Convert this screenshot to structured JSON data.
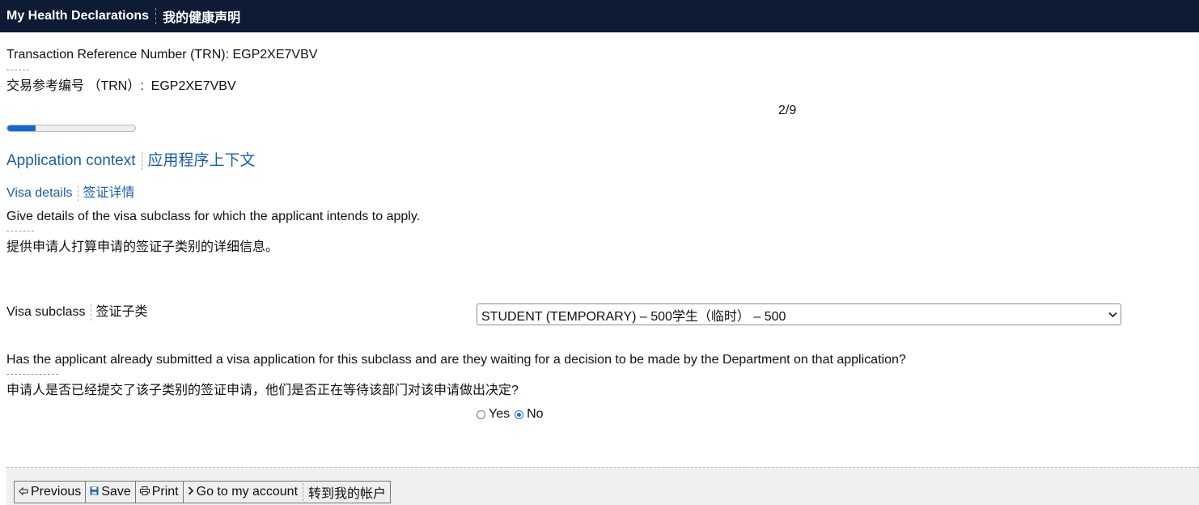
{
  "header": {
    "title_en": "My Health Declarations",
    "title_zh": "我的健康声明"
  },
  "trn": {
    "label_en": "Transaction Reference Number (TRN): EGP2XE7VBV",
    "label_zh": "交易参考编号 （TRN）:  EGP2XE7VBV"
  },
  "progress": {
    "text": "2/9",
    "fraction": 0.2222
  },
  "section": {
    "title_en": "Application context",
    "title_zh": "应用程序上下文"
  },
  "visa_details": {
    "title_en": "Visa details",
    "title_zh": "签证详情",
    "desc_en": "Give details of the visa subclass for which the applicant intends to apply.",
    "desc_zh": "提供申请人打算申请的签证子类别的详细信息。"
  },
  "visa_subclass": {
    "label_en": "Visa subclass",
    "label_zh": "签证子类",
    "selected": "STUDENT (TEMPORARY) – 500学生（临时） – 500"
  },
  "question": {
    "text_en": "Has the applicant already submitted a visa application for this subclass and are they waiting for a decision to be made by the Department on that application?",
    "text_zh": "申请人是否已经提交了该子类别的签证申请，他们是否正在等待该部门对该申请做出决定?",
    "yes_label": "Yes",
    "no_label": "No",
    "selected": "No"
  },
  "footer": {
    "previous_label": "Previous",
    "save_label": "Save",
    "print_label": "Print",
    "account_label_en": "Go to my account",
    "account_label_zh": "转到我的帐户"
  }
}
